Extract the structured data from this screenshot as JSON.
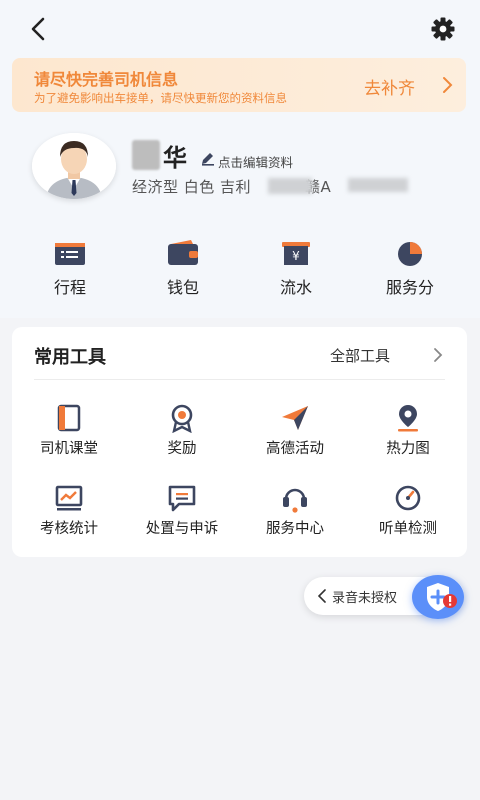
{
  "header": {
    "back_icon": "back-chevron-icon",
    "settings_icon": "gear-icon"
  },
  "banner": {
    "title": "请尽快完善司机信息",
    "subtitle": "为了避免影响出车接单，请尽快更新您的资料信息",
    "action": "去补齐"
  },
  "profile": {
    "name": "华",
    "edit_label": "点击编辑资料",
    "car_info": "经济型 白色 吉利",
    "plate_prefix": "赣A"
  },
  "quick_actions": [
    {
      "label": "行程",
      "icon": "trip-icon"
    },
    {
      "label": "钱包",
      "icon": "wallet-icon"
    },
    {
      "label": "流水",
      "icon": "flow-icon"
    },
    {
      "label": "服务分",
      "icon": "service-score-icon"
    }
  ],
  "tools": {
    "title": "常用工具",
    "all_label": "全部工具",
    "items": [
      {
        "label": "司机课堂",
        "icon": "classroom-icon"
      },
      {
        "label": "奖励",
        "icon": "reward-icon"
      },
      {
        "label": "高德活动",
        "icon": "activity-icon"
      },
      {
        "label": "热力图",
        "icon": "heatmap-icon"
      },
      {
        "label": "考核统计",
        "icon": "stats-icon"
      },
      {
        "label": "处置与申诉",
        "icon": "appeal-icon"
      },
      {
        "label": "服务中心",
        "icon": "service-center-icon"
      },
      {
        "label": "听单检测",
        "icon": "order-check-icon"
      }
    ]
  },
  "recording": {
    "label": "录音未授权"
  },
  "colors": {
    "accent": "#f0883a",
    "icon_dark": "#3d4660",
    "icon_orange": "#f07a3a",
    "fab": "#5b8ff9"
  }
}
